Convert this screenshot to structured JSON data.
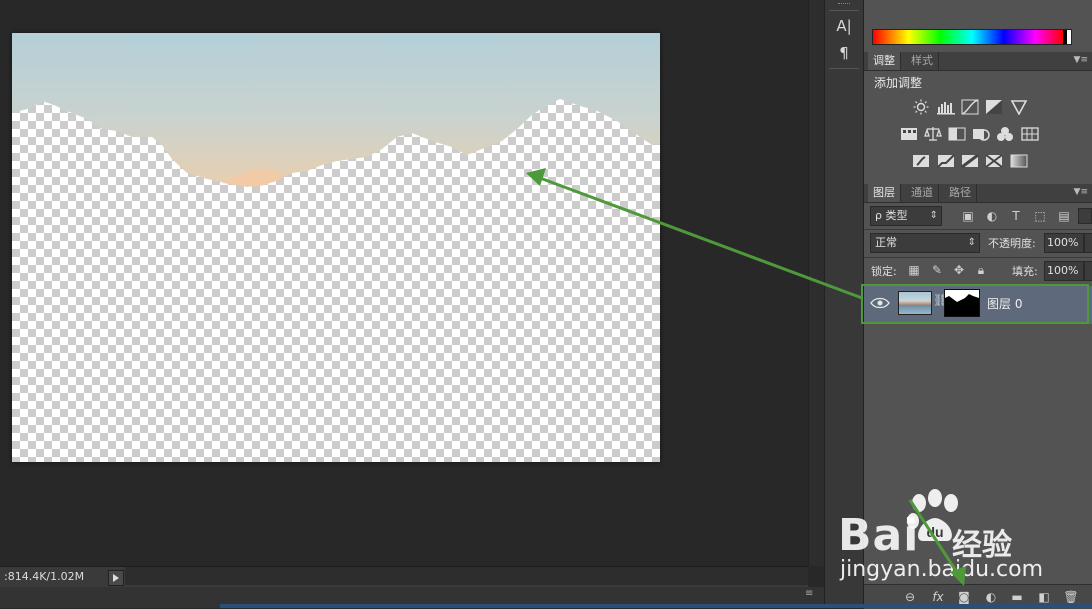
{
  "status": {
    "doc_size": ":814.4K/1.02M"
  },
  "tools": {
    "character_icon": "A|",
    "paragraph_icon": "¶"
  },
  "adjustments": {
    "tabs": [
      "调整",
      "样式"
    ],
    "title": "添加调整",
    "icons": [
      [
        "brightness-icon",
        "levels-icon",
        "curves-icon",
        "exposure-icon",
        "vibrance-icon"
      ],
      [
        "hue-icon",
        "color-balance-icon",
        "bw-icon",
        "photo-filter-icon",
        "channel-mixer-icon",
        "color-lookup-icon"
      ],
      [
        "invert-icon",
        "posterize-icon",
        "threshold-icon",
        "selective-color-icon",
        "gradient-map-icon"
      ]
    ]
  },
  "layers": {
    "tabs": [
      "图层",
      "通道",
      "路径"
    ],
    "filter_label": "ρ 类型",
    "blend_mode": "正常",
    "opacity_label": "不透明度:",
    "opacity_value": "100%",
    "lock_label": "锁定:",
    "fill_label": "填充:",
    "fill_value": "100%",
    "layer_name": "图层 0"
  },
  "footer_icons": [
    "link-icon",
    "fx-icon",
    "mask-icon",
    "adjustment-layer-icon",
    "folder-icon",
    "new-layer-icon",
    "trash-icon"
  ],
  "watermark": {
    "brand": "Bai",
    "brand_suffix": "经验",
    "url": "jingyan.baidu.com"
  },
  "colors": {
    "layer_selected": "#5e6a7c",
    "annotation_arrow": "#4e9a3a"
  }
}
